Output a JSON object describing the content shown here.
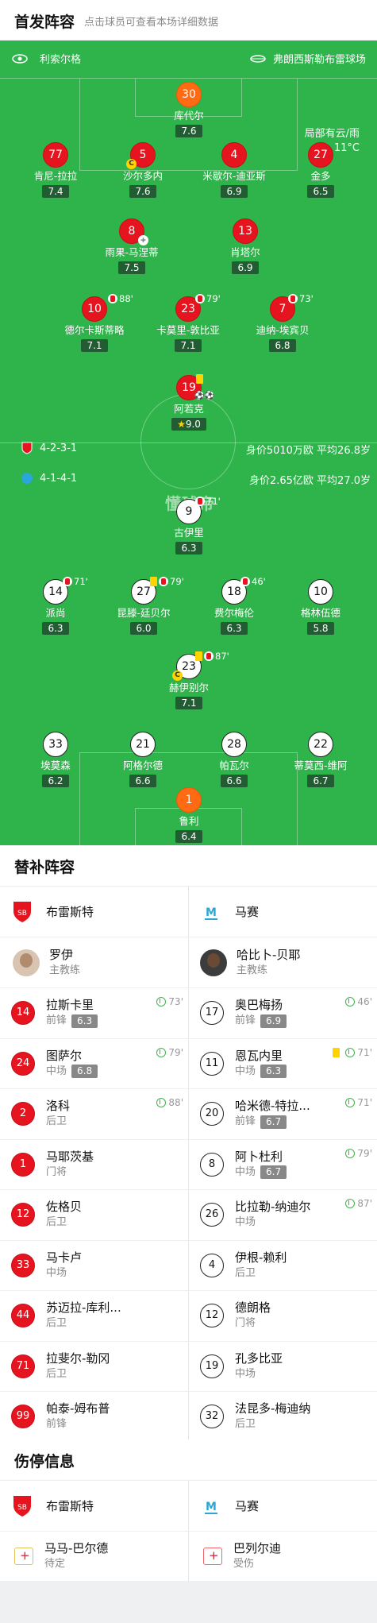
{
  "header": {
    "title": "首发阵容",
    "subtitle": "点击球员可查看本场详细数据"
  },
  "teams": {
    "home": "利索尔格",
    "away": "弗朗西斯勒布雷球场"
  },
  "weather": {
    "line1": "局部有云/雨",
    "line2": "11°C"
  },
  "watermark": "懂球帝",
  "brest": {
    "formation": "4-2-3-1",
    "value": "身价5010万欧  平均26.8岁",
    "players": [
      {
        "num": "30",
        "name": "库代尔",
        "rating": "7.6",
        "color": "orange"
      },
      {
        "num": "77",
        "name": "肯尼-拉拉",
        "rating": "7.4",
        "color": "red"
      },
      {
        "num": "5",
        "name": "沙尔多内",
        "rating": "7.6",
        "color": "red",
        "cap": "C"
      },
      {
        "num": "4",
        "name": "米歇尔-迪亚斯",
        "rating": "6.9",
        "color": "red"
      },
      {
        "num": "27",
        "name": "金多",
        "rating": "6.5",
        "color": "red"
      },
      {
        "num": "8",
        "name": "雨果-马涅蒂",
        "rating": "7.5",
        "color": "red"
      },
      {
        "num": "13",
        "name": "肖塔尔",
        "rating": "6.9",
        "color": "red"
      },
      {
        "num": "10",
        "name": "德尔卡斯蒂略",
        "rating": "7.1",
        "color": "red",
        "sub": "88'"
      },
      {
        "num": "23",
        "name": "卡莫里-敦比亚",
        "rating": "7.1",
        "color": "red",
        "sub": "79'"
      },
      {
        "num": "7",
        "name": "迪纳-埃宾贝",
        "rating": "6.8",
        "color": "red",
        "sub": "73'"
      },
      {
        "num": "19",
        "name": "阿若克",
        "rating": "9.0",
        "color": "red"
      }
    ]
  },
  "marseille": {
    "formation": "4-1-4-1",
    "value": "身价2.65亿欧  平均27.0岁",
    "players": [
      {
        "num": "9",
        "name": "古伊里",
        "rating": "6.3",
        "sub": "71'"
      },
      {
        "num": "14",
        "name": "派尚",
        "rating": "6.3",
        "sub": "71'"
      },
      {
        "num": "27",
        "name": "昆滕-廷贝尔",
        "rating": "6.0",
        "sub": "79'"
      },
      {
        "num": "18",
        "name": "费尔梅伦",
        "rating": "6.3",
        "sub": "46'"
      },
      {
        "num": "10",
        "name": "格林伍德",
        "rating": "5.8"
      },
      {
        "num": "23",
        "name": "赫伊别尔",
        "rating": "7.1",
        "sub": "87'",
        "cap": "C"
      },
      {
        "num": "33",
        "name": "埃莫森",
        "rating": "6.2"
      },
      {
        "num": "21",
        "name": "阿格尔德",
        "rating": "6.6"
      },
      {
        "num": "28",
        "name": "帕瓦尔",
        "rating": "6.6"
      },
      {
        "num": "22",
        "name": "蒂莫西-维阿",
        "rating": "6.7"
      },
      {
        "num": "1",
        "name": "鲁利",
        "rating": "6.4"
      }
    ]
  },
  "subs_section": {
    "title": "替补阵容",
    "home": "布雷斯特",
    "away": "马赛"
  },
  "coaches": {
    "home": {
      "name": "罗伊",
      "role": "主教练"
    },
    "away": {
      "name": "哈比卜-贝耶",
      "role": "主教练"
    }
  },
  "subs": [
    {
      "h": {
        "num": "14",
        "name": "拉斯卡里",
        "pos": "前锋",
        "rating": "6.3",
        "ev": "73'"
      },
      "a": {
        "num": "17",
        "name": "奥巴梅扬",
        "pos": "前锋",
        "rating": "6.9",
        "ev": "46'"
      }
    },
    {
      "h": {
        "num": "24",
        "name": "图萨尔",
        "pos": "中场",
        "rating": "6.8",
        "ev": "79'"
      },
      "a": {
        "num": "11",
        "name": "恩瓦内里",
        "pos": "中场",
        "rating": "6.3",
        "ev": "71'"
      }
    },
    {
      "h": {
        "num": "2",
        "name": "洛科",
        "pos": "后卫",
        "ev": "88'"
      },
      "a": {
        "num": "20",
        "name": "哈米德-特拉...",
        "pos": "前锋",
        "rating": "6.7",
        "ev": "71'"
      }
    },
    {
      "h": {
        "num": "1",
        "name": "马耶茨基",
        "pos": "门将"
      },
      "a": {
        "num": "8",
        "name": "阿卜杜利",
        "pos": "中场",
        "rating": "6.7",
        "ev": "79'"
      }
    },
    {
      "h": {
        "num": "12",
        "name": "佐格贝",
        "pos": "后卫"
      },
      "a": {
        "num": "26",
        "name": "比拉勒-纳迪尔",
        "pos": "中场",
        "ev": "87'"
      }
    },
    {
      "h": {
        "num": "33",
        "name": "马卡卢",
        "pos": "中场"
      },
      "a": {
        "num": "4",
        "name": "伊根-赖利",
        "pos": "后卫"
      }
    },
    {
      "h": {
        "num": "44",
        "name": "苏迈拉-库利...",
        "pos": "后卫"
      },
      "a": {
        "num": "12",
        "name": "德朗格",
        "pos": "门将"
      }
    },
    {
      "h": {
        "num": "71",
        "name": "拉斐尔-勒冈",
        "pos": "后卫"
      },
      "a": {
        "num": "19",
        "name": "孔多比亚",
        "pos": "中场"
      }
    },
    {
      "h": {
        "num": "99",
        "name": "帕泰-姆布普",
        "pos": "前锋"
      },
      "a": {
        "num": "32",
        "name": "法昆多-梅迪纳",
        "pos": "后卫"
      }
    }
  ],
  "injury": {
    "title": "伤停信息",
    "home": "布雷斯特",
    "away": "马赛",
    "h": {
      "name": "马马-巴尔德",
      "status": "待定"
    },
    "a": {
      "name": "巴列尔迪",
      "status": "受伤"
    }
  },
  "colors": {
    "pitch": "#2fb34b",
    "red": "#e6141f",
    "orange": "#ff6a13"
  }
}
